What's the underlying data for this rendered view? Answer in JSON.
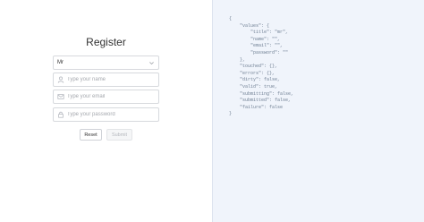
{
  "form": {
    "title": "Register",
    "title_select": {
      "value": "Mr"
    },
    "name_field": {
      "placeholder": "Type your name"
    },
    "email_field": {
      "placeholder": "Type your email"
    },
    "password_field": {
      "placeholder": "Type your password"
    },
    "reset_label": "Reset",
    "submit_label": "Submit"
  },
  "state_panel": {
    "lines": [
      "{",
      "    \"values\": {",
      "        \"title\": \"mr\",",
      "        \"name\": \"\",",
      "        \"email\": \"\",",
      "        \"password\": \"\"",
      "    },",
      "    \"touched\": {},",
      "    \"errors\": {},",
      "    \"dirty\": false,",
      "    \"valid\": true,",
      "    \"submitting\": false,",
      "    \"submitted\": false,",
      "    \"failure\": false",
      "}"
    ]
  },
  "colors": {
    "panel_background": "#f0f4fb",
    "code_text": "#6f7f93",
    "field_border": "#d7d9dd"
  }
}
